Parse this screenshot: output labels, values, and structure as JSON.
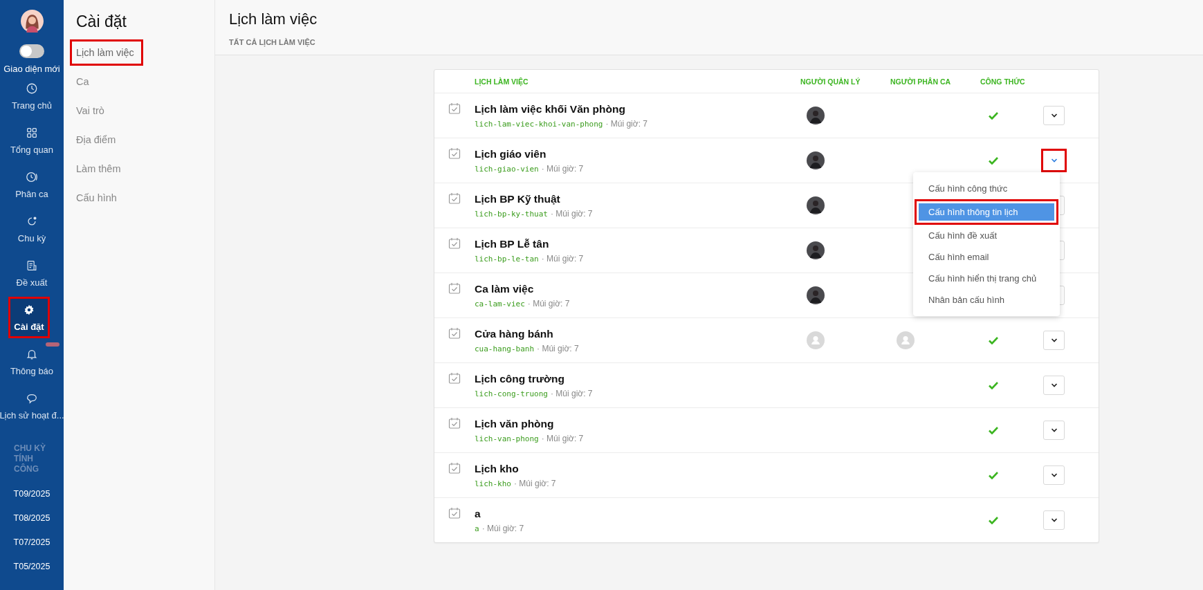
{
  "nav": {
    "toggle": {
      "label": "Giao diện mới",
      "on": false
    },
    "items": [
      {
        "label": "Trang chủ",
        "selected": false,
        "highlighted": false,
        "badge": false
      },
      {
        "label": "Tổng quan",
        "selected": false,
        "highlighted": false,
        "badge": false
      },
      {
        "label": "Phân ca",
        "selected": false,
        "highlighted": false,
        "badge": false
      },
      {
        "label": "Chu kỳ",
        "selected": false,
        "highlighted": false,
        "badge": false
      },
      {
        "label": "Đề xuất",
        "selected": false,
        "highlighted": false,
        "badge": false
      },
      {
        "label": "Cài đặt",
        "selected": true,
        "highlighted": true,
        "badge": false
      },
      {
        "label": "Thông báo",
        "selected": false,
        "highlighted": false,
        "badge": true
      },
      {
        "label": "Lịch sử hoạt đ...",
        "selected": false,
        "highlighted": false,
        "badge": false
      }
    ],
    "periods_heading": "CHU KỲ TÍNH CÔNG",
    "periods": [
      "T09/2025",
      "T08/2025",
      "T07/2025",
      "T05/2025"
    ]
  },
  "settings": {
    "title": "Cài đặt",
    "items": [
      {
        "label": "Lịch làm việc",
        "selected": true,
        "highlighted": true
      },
      {
        "label": "Ca",
        "selected": false,
        "highlighted": false
      },
      {
        "label": "Vai trò",
        "selected": false,
        "highlighted": false
      },
      {
        "label": "Địa điểm",
        "selected": false,
        "highlighted": false
      },
      {
        "label": "Làm thêm",
        "selected": false,
        "highlighted": false
      },
      {
        "label": "Cấu hình",
        "selected": false,
        "highlighted": false
      }
    ]
  },
  "page": {
    "title": "Lịch làm việc",
    "subtitle": "TẤT CẢ LỊCH LÀM VIỆC"
  },
  "table": {
    "columns": [
      "LỊCH LÀM VIỆC",
      "NGƯỜI QUẢN LÝ",
      "NGƯỜI PHÂN CA",
      "CÔNG THỨC"
    ],
    "rows": [
      {
        "name": "Lịch làm việc khối Văn phòng",
        "slug": "lich-lam-viec-khoi-van-phong",
        "timezone": "· Múi giờ: 7",
        "manager": {
          "kind": "photo"
        },
        "formula": true,
        "menu_open": false,
        "highlighted": false
      },
      {
        "name": "Lịch giáo viên",
        "slug": "lich-giao-vien",
        "timezone": "· Múi giờ: 7",
        "manager": {
          "kind": "photo"
        },
        "formula": true,
        "menu_open": true,
        "highlighted": true
      },
      {
        "name": "Lịch BP Kỹ thuật",
        "slug": "lich-bp-ky-thuat",
        "timezone": "· Múi giờ: 7",
        "manager": {
          "kind": "photo"
        },
        "menu_open": false,
        "highlighted": false
      },
      {
        "name": "Lịch BP Lễ tân",
        "slug": "lich-bp-le-tan",
        "timezone": "· Múi giờ: 7",
        "manager": {
          "kind": "photo"
        },
        "menu_open": false,
        "highlighted": false
      },
      {
        "name": "Ca làm việc",
        "slug": "ca-lam-viec",
        "timezone": "· Múi giờ: 7",
        "manager": {
          "kind": "photo"
        },
        "menu_open": false,
        "highlighted": false
      },
      {
        "name": "Cửa hàng bánh",
        "slug": "cua-hang-banh",
        "timezone": "· Múi giờ: 7",
        "manager": {
          "kind": "placeholder"
        },
        "scheduler": {
          "kind": "placeholder"
        },
        "formula": true,
        "menu_open": false,
        "highlighted": false
      },
      {
        "name": "Lịch công trường",
        "slug": "lich-cong-truong",
        "timezone": "· Múi giờ: 7",
        "formula": true,
        "menu_open": false,
        "highlighted": false
      },
      {
        "name": "Lịch văn phòng",
        "slug": "lich-van-phong",
        "timezone": "· Múi giờ: 7",
        "formula": true,
        "menu_open": false,
        "highlighted": false
      },
      {
        "name": "Lịch kho",
        "slug": "lich-kho",
        "timezone": "· Múi giờ: 7",
        "formula": true,
        "menu_open": false,
        "highlighted": false
      },
      {
        "name": "a",
        "slug": "a",
        "timezone": "· Múi giờ: 7",
        "formula": true,
        "menu_open": false,
        "highlighted": false
      }
    ]
  },
  "menu": {
    "items": [
      {
        "label": "Cấu hình công thức",
        "selected": false,
        "highlighted": false
      },
      {
        "label": "Cấu hình thông tin lịch",
        "selected": true,
        "highlighted": true
      },
      {
        "label": "Cấu hình đề xuất",
        "selected": false,
        "highlighted": false
      },
      {
        "label": "Cấu hình email",
        "selected": false,
        "highlighted": false
      },
      {
        "label": "Cấu hình hiển thị trang chủ",
        "selected": false,
        "highlighted": false
      },
      {
        "label": "Nhân bản cấu hình",
        "selected": false,
        "highlighted": false
      }
    ]
  }
}
